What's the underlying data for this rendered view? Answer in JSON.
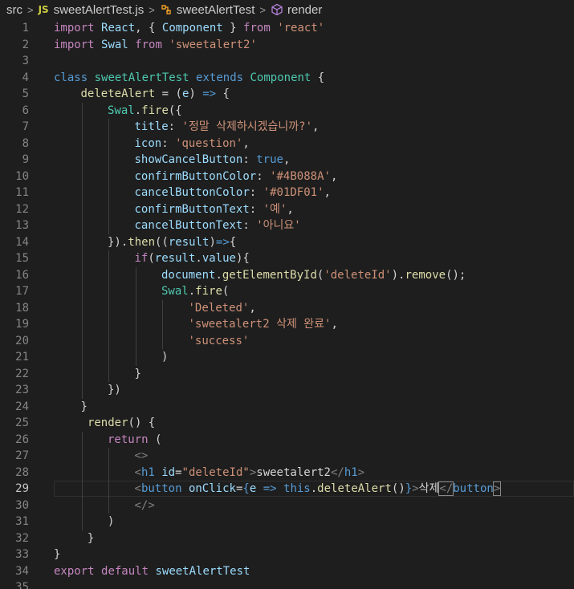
{
  "breadcrumb": {
    "folder": "src",
    "file_badge": "JS",
    "file": "sweetAlertTest.js",
    "class_name": "sweetAlertTest",
    "method": "render"
  },
  "editor": {
    "current_line": 29,
    "lines": [
      {
        "n": "1",
        "indent": 0,
        "tokens": [
          [
            "import",
            "ctl"
          ],
          [
            " ",
            "txt"
          ],
          [
            "React",
            "prop"
          ],
          [
            ", { ",
            "txt"
          ],
          [
            "Component",
            "prop"
          ],
          [
            " } ",
            "txt"
          ],
          [
            "from",
            "ctl"
          ],
          [
            " ",
            "txt"
          ],
          [
            "'react'",
            "str"
          ]
        ]
      },
      {
        "n": "2",
        "indent": 0,
        "tokens": [
          [
            "import",
            "ctl"
          ],
          [
            " ",
            "txt"
          ],
          [
            "Swal",
            "prop"
          ],
          [
            " ",
            "txt"
          ],
          [
            "from",
            "ctl"
          ],
          [
            " ",
            "txt"
          ],
          [
            "'sweetalert2'",
            "str"
          ]
        ]
      },
      {
        "n": "3",
        "indent": 0,
        "tokens": []
      },
      {
        "n": "4",
        "indent": 0,
        "tokens": [
          [
            "class",
            "kw"
          ],
          [
            " ",
            "txt"
          ],
          [
            "sweetAlertTest",
            "cls"
          ],
          [
            " ",
            "txt"
          ],
          [
            "extends",
            "kw"
          ],
          [
            " ",
            "txt"
          ],
          [
            "Component",
            "cls"
          ],
          [
            " {",
            "txt"
          ]
        ]
      },
      {
        "n": "5",
        "indent": 1,
        "tokens": [
          [
            "deleteAlert",
            "fn"
          ],
          [
            " = (",
            "txt"
          ],
          [
            "e",
            "prop"
          ],
          [
            ") ",
            "txt"
          ],
          [
            "=>",
            "kw"
          ],
          [
            " {",
            "txt"
          ]
        ]
      },
      {
        "n": "6",
        "indent": 2,
        "tokens": [
          [
            "Swal",
            "cls"
          ],
          [
            ".",
            "txt"
          ],
          [
            "fire",
            "fn"
          ],
          [
            "({",
            "txt"
          ]
        ]
      },
      {
        "n": "7",
        "indent": 3,
        "tokens": [
          [
            "title",
            "prop"
          ],
          [
            ": ",
            "txt"
          ],
          [
            "'정말 삭제하시겠습니까?'",
            "str"
          ],
          [
            ",",
            "txt"
          ]
        ]
      },
      {
        "n": "8",
        "indent": 3,
        "tokens": [
          [
            "icon",
            "prop"
          ],
          [
            ": ",
            "txt"
          ],
          [
            "'question'",
            "str"
          ],
          [
            ",",
            "txt"
          ]
        ]
      },
      {
        "n": "9",
        "indent": 3,
        "tokens": [
          [
            "showCancelButton",
            "prop"
          ],
          [
            ": ",
            "txt"
          ],
          [
            "true",
            "kw"
          ],
          [
            ",",
            "txt"
          ]
        ]
      },
      {
        "n": "10",
        "indent": 3,
        "tokens": [
          [
            "confirmButtonColor",
            "prop"
          ],
          [
            ": ",
            "txt"
          ],
          [
            "'#4B088A'",
            "str"
          ],
          [
            ",",
            "txt"
          ]
        ]
      },
      {
        "n": "11",
        "indent": 3,
        "tokens": [
          [
            "cancelButtonColor",
            "prop"
          ],
          [
            ": ",
            "txt"
          ],
          [
            "'#01DF01'",
            "str"
          ],
          [
            ",",
            "txt"
          ]
        ]
      },
      {
        "n": "12",
        "indent": 3,
        "tokens": [
          [
            "confirmButtonText",
            "prop"
          ],
          [
            ": ",
            "txt"
          ],
          [
            "'예'",
            "str"
          ],
          [
            ",",
            "txt"
          ]
        ]
      },
      {
        "n": "13",
        "indent": 3,
        "tokens": [
          [
            "cancelButtonText",
            "prop"
          ],
          [
            ": ",
            "txt"
          ],
          [
            "'아니요'",
            "str"
          ]
        ]
      },
      {
        "n": "14",
        "indent": 2,
        "tokens": [
          [
            "}).",
            "txt"
          ],
          [
            "then",
            "fn"
          ],
          [
            "((",
            "txt"
          ],
          [
            "result",
            "prop"
          ],
          [
            ")",
            "txt"
          ],
          [
            "=>",
            "kw"
          ],
          [
            "{",
            "txt"
          ]
        ]
      },
      {
        "n": "15",
        "indent": 3,
        "tokens": [
          [
            "if",
            "ctl"
          ],
          [
            "(",
            "txt"
          ],
          [
            "result",
            "prop"
          ],
          [
            ".",
            "txt"
          ],
          [
            "value",
            "prop"
          ],
          [
            "){",
            "txt"
          ]
        ]
      },
      {
        "n": "16",
        "indent": 4,
        "tokens": [
          [
            "document",
            "prop"
          ],
          [
            ".",
            "txt"
          ],
          [
            "getElementById",
            "fn"
          ],
          [
            "(",
            "txt"
          ],
          [
            "'deleteId'",
            "str"
          ],
          [
            ").",
            "txt"
          ],
          [
            "remove",
            "fn"
          ],
          [
            "();",
            "txt"
          ]
        ]
      },
      {
        "n": "17",
        "indent": 4,
        "tokens": [
          [
            "Swal",
            "cls"
          ],
          [
            ".",
            "txt"
          ],
          [
            "fire",
            "fn"
          ],
          [
            "(",
            "txt"
          ]
        ]
      },
      {
        "n": "18",
        "indent": 5,
        "tokens": [
          [
            "'Deleted'",
            "str"
          ],
          [
            ",",
            "txt"
          ]
        ]
      },
      {
        "n": "19",
        "indent": 5,
        "tokens": [
          [
            "'sweetalert2 삭제 완료'",
            "str"
          ],
          [
            ",",
            "txt"
          ]
        ]
      },
      {
        "n": "20",
        "indent": 5,
        "tokens": [
          [
            "'success'",
            "str"
          ]
        ]
      },
      {
        "n": "21",
        "indent": 4,
        "tokens": [
          [
            ")",
            "txt"
          ]
        ]
      },
      {
        "n": "22",
        "indent": 3,
        "tokens": [
          [
            "}",
            "txt"
          ]
        ]
      },
      {
        "n": "23",
        "indent": 2,
        "tokens": [
          [
            "})",
            "txt"
          ]
        ]
      },
      {
        "n": "24",
        "indent": 1,
        "tokens": [
          [
            "}",
            "txt"
          ]
        ]
      },
      {
        "n": "25",
        "indent": 1,
        "tokens": [
          [
            " ",
            "txt"
          ],
          [
            "render",
            "fn"
          ],
          [
            "() {",
            "txt"
          ]
        ]
      },
      {
        "n": "26",
        "indent": 2,
        "tokens": [
          [
            "return",
            "ctl"
          ],
          [
            " (",
            "txt"
          ]
        ]
      },
      {
        "n": "27",
        "indent": 3,
        "tokens": [
          [
            "<>",
            "ang"
          ]
        ]
      },
      {
        "n": "28",
        "indent": 3,
        "tokens": [
          [
            "<",
            "ang"
          ],
          [
            "h1",
            "tag"
          ],
          [
            " ",
            "txt"
          ],
          [
            "id",
            "prop"
          ],
          [
            "=",
            "txt"
          ],
          [
            "\"deleteId\"",
            "str"
          ],
          [
            ">",
            "ang"
          ],
          [
            "sweetalert2",
            "txt"
          ],
          [
            "</",
            "ang"
          ],
          [
            "h1",
            "tag"
          ],
          [
            ">",
            "ang"
          ]
        ]
      },
      {
        "n": "29",
        "indent": 3,
        "tokens": [
          [
            "<",
            "ang"
          ],
          [
            "button",
            "tag"
          ],
          [
            " ",
            "txt"
          ],
          [
            "onClick",
            "prop"
          ],
          [
            "=",
            "txt"
          ],
          [
            "{",
            "kw"
          ],
          [
            "e",
            "prop"
          ],
          [
            " ",
            "txt"
          ],
          [
            "=>",
            "kw"
          ],
          [
            " ",
            "txt"
          ],
          [
            "this",
            "kw"
          ],
          [
            ".",
            "txt"
          ],
          [
            "deleteAlert",
            "fn"
          ],
          [
            "()",
            "txt"
          ],
          [
            "}",
            "kw"
          ],
          [
            ">",
            "ang"
          ],
          [
            "삭제",
            "txt"
          ],
          [
            "</",
            "ang"
          ],
          [
            "button",
            "tag"
          ],
          [
            ">",
            "ang"
          ]
        ]
      },
      {
        "n": "30",
        "indent": 3,
        "tokens": [
          [
            "</>",
            "ang"
          ]
        ]
      },
      {
        "n": "31",
        "indent": 2,
        "tokens": [
          [
            ")",
            "txt"
          ]
        ]
      },
      {
        "n": "32",
        "indent": 1,
        "tokens": [
          [
            " }",
            "txt"
          ]
        ]
      },
      {
        "n": "33",
        "indent": 0,
        "tokens": [
          [
            "}",
            "txt"
          ]
        ]
      },
      {
        "n": "34",
        "indent": 0,
        "tokens": [
          [
            "export",
            "ctl"
          ],
          [
            " ",
            "txt"
          ],
          [
            "default",
            "ctl"
          ],
          [
            " ",
            "txt"
          ],
          [
            "sweetAlertTest",
            "prop"
          ]
        ]
      },
      {
        "n": "35",
        "indent": 0,
        "tokens": []
      }
    ]
  }
}
